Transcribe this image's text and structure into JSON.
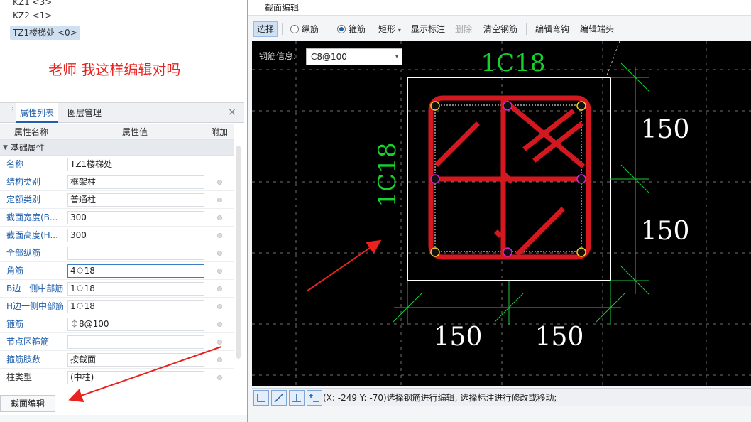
{
  "component_list": {
    "items": [
      {
        "label": "KZ1 <3>"
      },
      {
        "label": "KZ2 <1>"
      },
      {
        "label": "TZ1楼梯处 <0>"
      }
    ]
  },
  "annotation_comment": "老师 我这样编辑对吗",
  "panel": {
    "tabs": [
      "属性列表",
      "图层管理"
    ],
    "close_symbol": "×",
    "columns": [
      "属性名称",
      "属性值",
      "附加"
    ],
    "group": "基础属性",
    "rows": [
      {
        "name": "名称",
        "value": "TZ1楼梯处"
      },
      {
        "name": "结构类别",
        "value": "框架柱"
      },
      {
        "name": "定额类别",
        "value": "普通柱"
      },
      {
        "name": "截面宽度(B...",
        "value": "300"
      },
      {
        "name": "截面高度(H...",
        "value": "300"
      },
      {
        "name": "全部纵筋",
        "value": ""
      },
      {
        "name": "角筋",
        "value": "4⏀18"
      },
      {
        "name": "B边一侧中部筋",
        "value": "1⏀18"
      },
      {
        "name": "H边一侧中部筋",
        "value": "1⏀18"
      },
      {
        "name": "箍筋",
        "value": "⏀8@100"
      },
      {
        "name": "节点区箍筋",
        "value": ""
      },
      {
        "name": "箍筋肢数",
        "value": "按截面"
      },
      {
        "name": "柱类型",
        "value": "(中柱)"
      }
    ],
    "section_edit_button": "截面编辑"
  },
  "dialog": {
    "title": "截面编辑",
    "toolbar": {
      "select": "选择",
      "longitudinal": "纵筋",
      "stirrup": "箍筋",
      "rectangle": "矩形",
      "rectangle_arrow": "▾",
      "show_dims": "显示标注",
      "delete": "删除",
      "clear": "清空钢筋",
      "edit_hook": "编辑弯钩",
      "edit_end": "编辑端头"
    },
    "rebar_info_label": "钢筋信息:",
    "rebar_info_value": "C8@100",
    "rebar_info_arrow": "▾",
    "status_text": "(X: -249 Y: -70)选择钢筋进行编辑, 选择标注进行修改或移动;"
  },
  "drawing": {
    "top_label": "1C18",
    "side_label": "1C18",
    "dims_right": [
      "150",
      "150"
    ],
    "dims_bottom": [
      "150",
      "150"
    ],
    "colors": {
      "canvas": "#000000",
      "stirrup": "#d4181f",
      "dimension": "#19c83a",
      "label": "#17d22e",
      "outline": "#ffffff",
      "corner_bar": "#f0d21a",
      "mid_bar": "#d126d8",
      "annotation_arrow": "#e8231f"
    }
  }
}
